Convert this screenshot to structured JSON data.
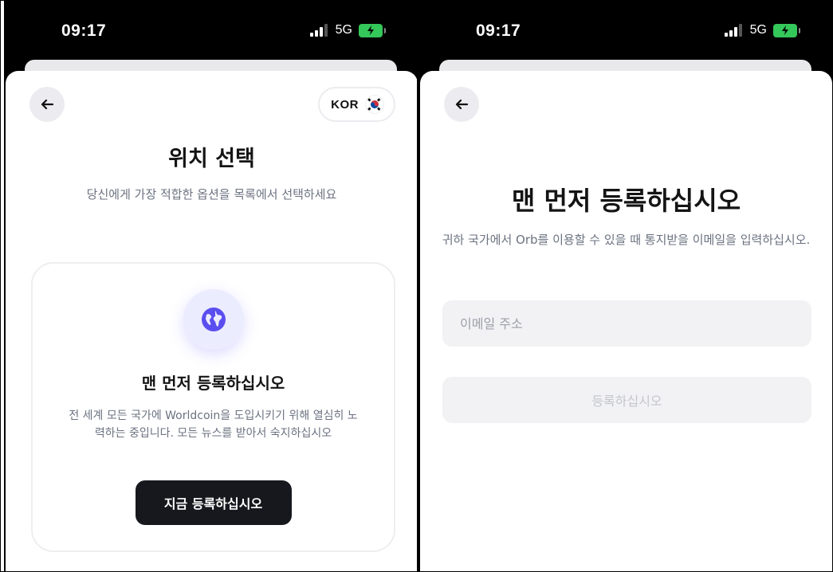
{
  "left_screen": {
    "status": {
      "time": "09:17",
      "network": "5G"
    },
    "header": {
      "country_code": "KOR",
      "country_flag": "south-korea-flag-icon"
    },
    "title": "위치 선택",
    "subtitle": "당신에게 가장 적합한 옵션을 목록에서 선택하세요",
    "card": {
      "icon": "globe-icon",
      "title": "맨 먼저 등록하십시오",
      "body": "전 세계 모든 국가에 Worldcoin을 도입시키기 위해 열심히 노력하는 중입니다. 모든 뉴스를 받아서 숙지하십시오",
      "cta_label": "지금 등록하십시오"
    }
  },
  "right_screen": {
    "status": {
      "time": "09:17",
      "network": "5G"
    },
    "title": "맨 먼저 등록하십시오",
    "subtitle": "귀하 국가에서 Orb를 이용할 수 있을 때 통지받을 이메일을 입력하십시오.",
    "email": {
      "placeholder": "이메일 주소",
      "value": ""
    },
    "submit_label": "등록하십시오"
  },
  "colors": {
    "accent": "#5b4ef0",
    "primary_button": "#16181d",
    "disabled_button_bg": "#f2f2f4",
    "battery": "#34c759"
  }
}
